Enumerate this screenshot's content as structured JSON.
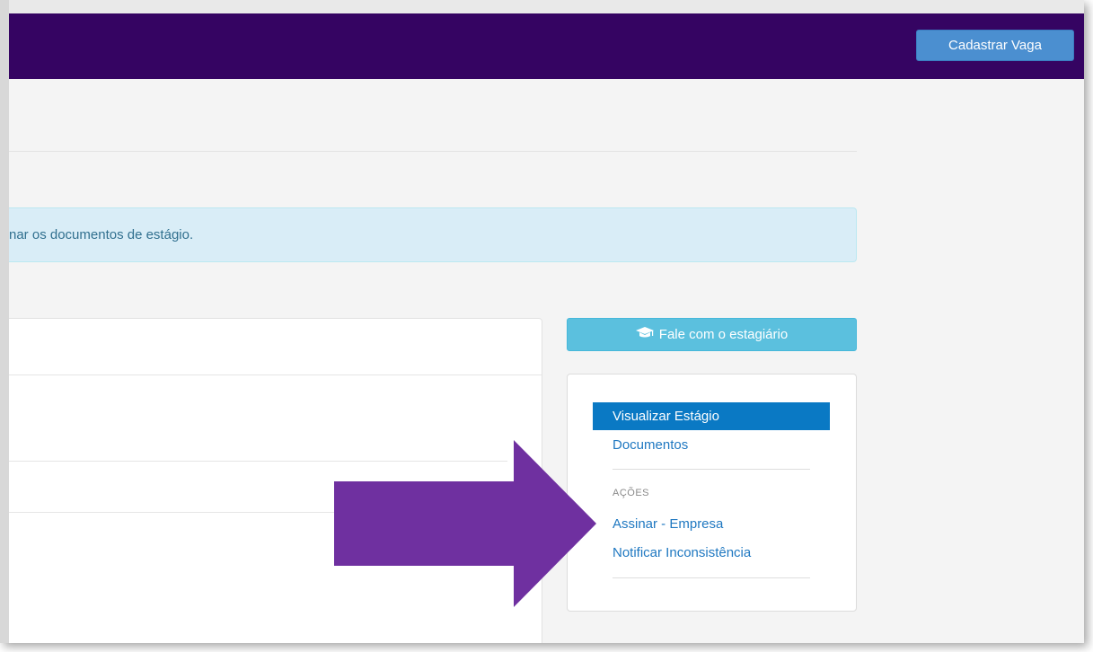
{
  "header": {
    "cadastrar_label": "Cadastrar Vaga"
  },
  "alert": {
    "text": "nar os documentos de estágio."
  },
  "actions": {
    "fale_label": "Fale com o estagiário"
  },
  "menu": {
    "items": [
      {
        "label": "Visualizar Estágio",
        "active": true
      },
      {
        "label": "Documentos",
        "active": false
      }
    ],
    "acoes_header": "AÇÕES",
    "acoes": [
      {
        "label": "Assinar - Empresa"
      },
      {
        "label": "Notificar Inconsistência"
      }
    ]
  },
  "colors": {
    "topbar": "#350462",
    "primary": "#4b8fd0",
    "info": "#5bc0de",
    "active": "#0a79c4",
    "link": "#1f78c1",
    "arrow": "#6f30a0"
  },
  "icons": {
    "fale_icon": "graduation-cap-icon",
    "annotation": "arrow-right-icon"
  }
}
